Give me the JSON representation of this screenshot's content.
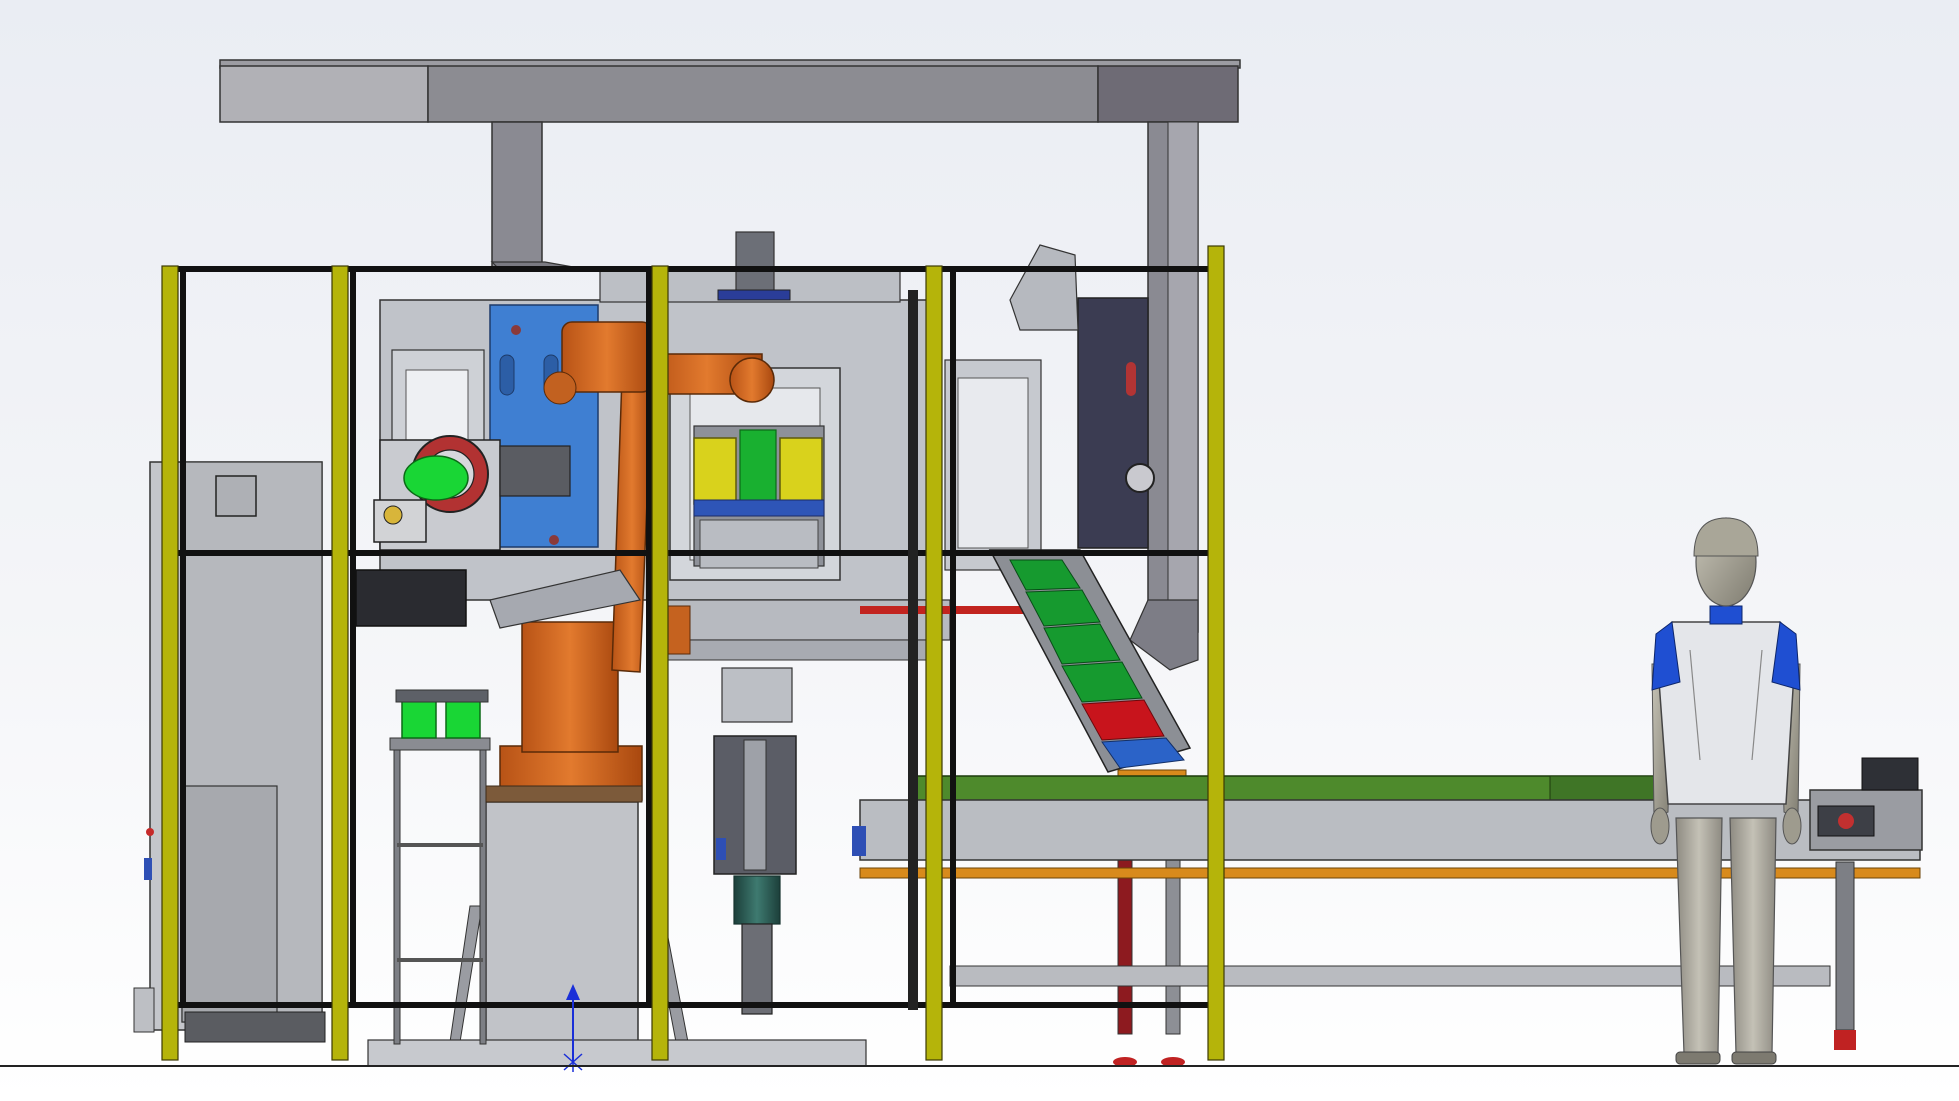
{
  "scene": {
    "kind": "cad-3d-view",
    "components": [
      "overhead-gantry-beam",
      "safety-fence",
      "electrical-cabinet",
      "industrial-robot-arm",
      "machining-center",
      "gripper-fixture",
      "vertical-spindle",
      "inclined-chute-conveyor",
      "belt-conveyor",
      "human-mannequin",
      "coordinate-triad"
    ]
  },
  "colors": {
    "background_top": "#eef0f5",
    "background_bottom": "#ffffff",
    "fence_yellow": "#b5b40a",
    "fence_black": "#111111",
    "robot_orange": "#d46a22",
    "machine_blue": "#3f7fd2",
    "machine_grey": "#b9bcc2",
    "gripper_green": "#19d635",
    "fixture_yellow": "#d9d21c",
    "chute_green": "#169a2f",
    "chute_red": "#c8141c",
    "conveyor_green": "#4e8a2c",
    "conveyor_orange": "#d88a1c",
    "mannequin_blue": "#1f4fd2",
    "triad_blue": "#1a2fd8"
  }
}
